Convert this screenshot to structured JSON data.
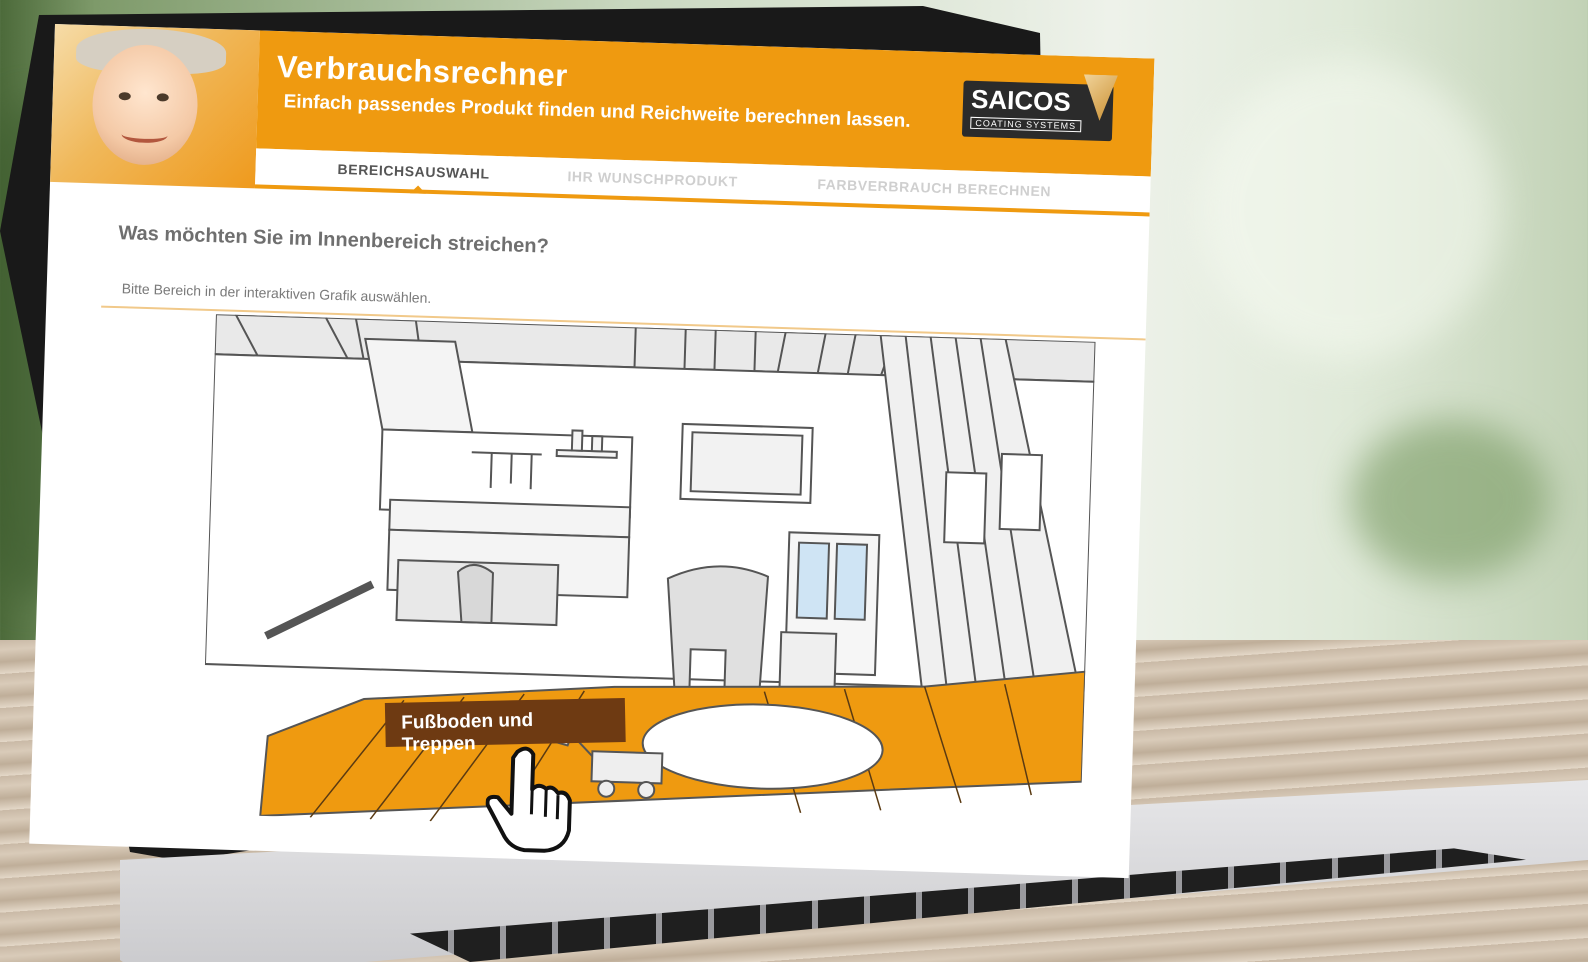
{
  "header": {
    "title": "Verbrauchsrechner",
    "subtitle": "Einfach passendes Produkt finden und Reichweite berechnen lassen."
  },
  "logo": {
    "main": "SAICOS",
    "sub": "COATING SYSTEMS"
  },
  "tabs": [
    {
      "label": "BEREICHSAUSWAHL",
      "active": true
    },
    {
      "label": "IHR WUNSCHPRODUKT",
      "active": false
    },
    {
      "label": "FARBVERBRAUCH BERECHNEN",
      "active": false
    }
  ],
  "content": {
    "question": "Was möchten Sie im Innenbereich streichen?",
    "hint": "Bitte Bereich in der interaktiven Grafik auswählen.",
    "hover_label": "Fußboden und Treppen"
  },
  "colors": {
    "accent": "#ef9a10",
    "label_bg": "#6e3a12"
  }
}
